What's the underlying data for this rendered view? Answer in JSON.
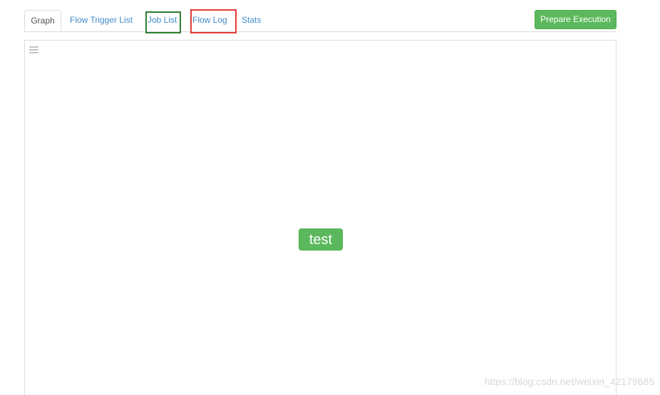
{
  "tabs": [
    {
      "label": "Graph",
      "active": true
    },
    {
      "label": "Flow Trigger List",
      "active": false
    },
    {
      "label": "Job List",
      "active": false
    },
    {
      "label": "Flow Log",
      "active": false
    },
    {
      "label": "Stats",
      "active": false
    }
  ],
  "toolbar": {
    "prepare_label": "Prepare Execution"
  },
  "graph": {
    "panel_icon": "list-icon",
    "nodes": [
      {
        "label": "test",
        "status_color": "#5cb85c"
      }
    ]
  },
  "watermark": "https://blog.csdn.net/weixin_42179685",
  "colors": {
    "accent_link": "#428bca",
    "success": "#5cb85c",
    "highlight_job_list": "#2e7d32",
    "highlight_flow_log": "#e53935"
  }
}
